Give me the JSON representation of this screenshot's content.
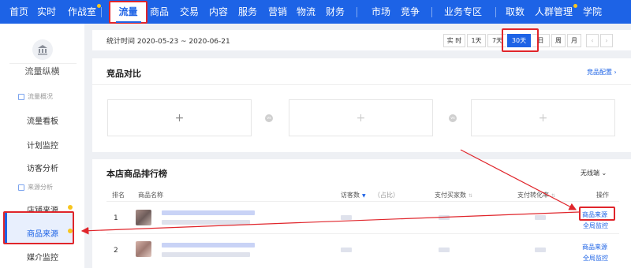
{
  "topnav": {
    "items": [
      {
        "label": "首页"
      },
      {
        "label": "实时"
      },
      {
        "label": "作战室"
      },
      {
        "label": "流量"
      },
      {
        "label": "商品"
      },
      {
        "label": "交易"
      },
      {
        "label": "内容"
      },
      {
        "label": "服务"
      },
      {
        "label": "营销"
      },
      {
        "label": "物流"
      },
      {
        "label": "财务"
      },
      {
        "label": "市场"
      },
      {
        "label": "竞争"
      },
      {
        "label": "业务专区"
      },
      {
        "label": "取数"
      },
      {
        "label": "人群管理"
      },
      {
        "label": "学院"
      }
    ],
    "active": "流量"
  },
  "sidebar": {
    "title": "流量纵横",
    "groups": [
      {
        "label": "流量概况",
        "items": [
          "流量看板",
          "计划监控",
          "访客分析"
        ]
      },
      {
        "label": "来源分析",
        "items": [
          "店铺来源",
          "商品来源",
          "媒介监控"
        ]
      }
    ],
    "active_item": "商品来源"
  },
  "datebar": {
    "label": "统计时间 2020-05-23 ~ 2020-06-21",
    "segments": [
      "实 时",
      "1天",
      "7天",
      "30天",
      "日",
      "周",
      "月"
    ],
    "active_segment": "30天",
    "prev": "‹",
    "next": "›"
  },
  "compare": {
    "title": "竞品对比",
    "config_link": "竞品配置 ›",
    "add": "+",
    "vs": "vs"
  },
  "ranking": {
    "title": "本店商品排行榜",
    "device": "无线端 ⌄",
    "headers": {
      "rank": "排名",
      "name": "商品名称",
      "visitors": "访客数",
      "share": "（占比）",
      "buyers": "支付买家数",
      "conversion": "支付转化率",
      "ops": "操作"
    },
    "rows": [
      {
        "rank": "1",
        "op1": "商品来源",
        "op2": "全局监控"
      },
      {
        "rank": "2",
        "op1": "商品来源",
        "op2": "全局监控"
      }
    ]
  },
  "colors": {
    "brand": "#1d63e6",
    "annotation": "#e0252b",
    "badge": "#f7c51e"
  }
}
